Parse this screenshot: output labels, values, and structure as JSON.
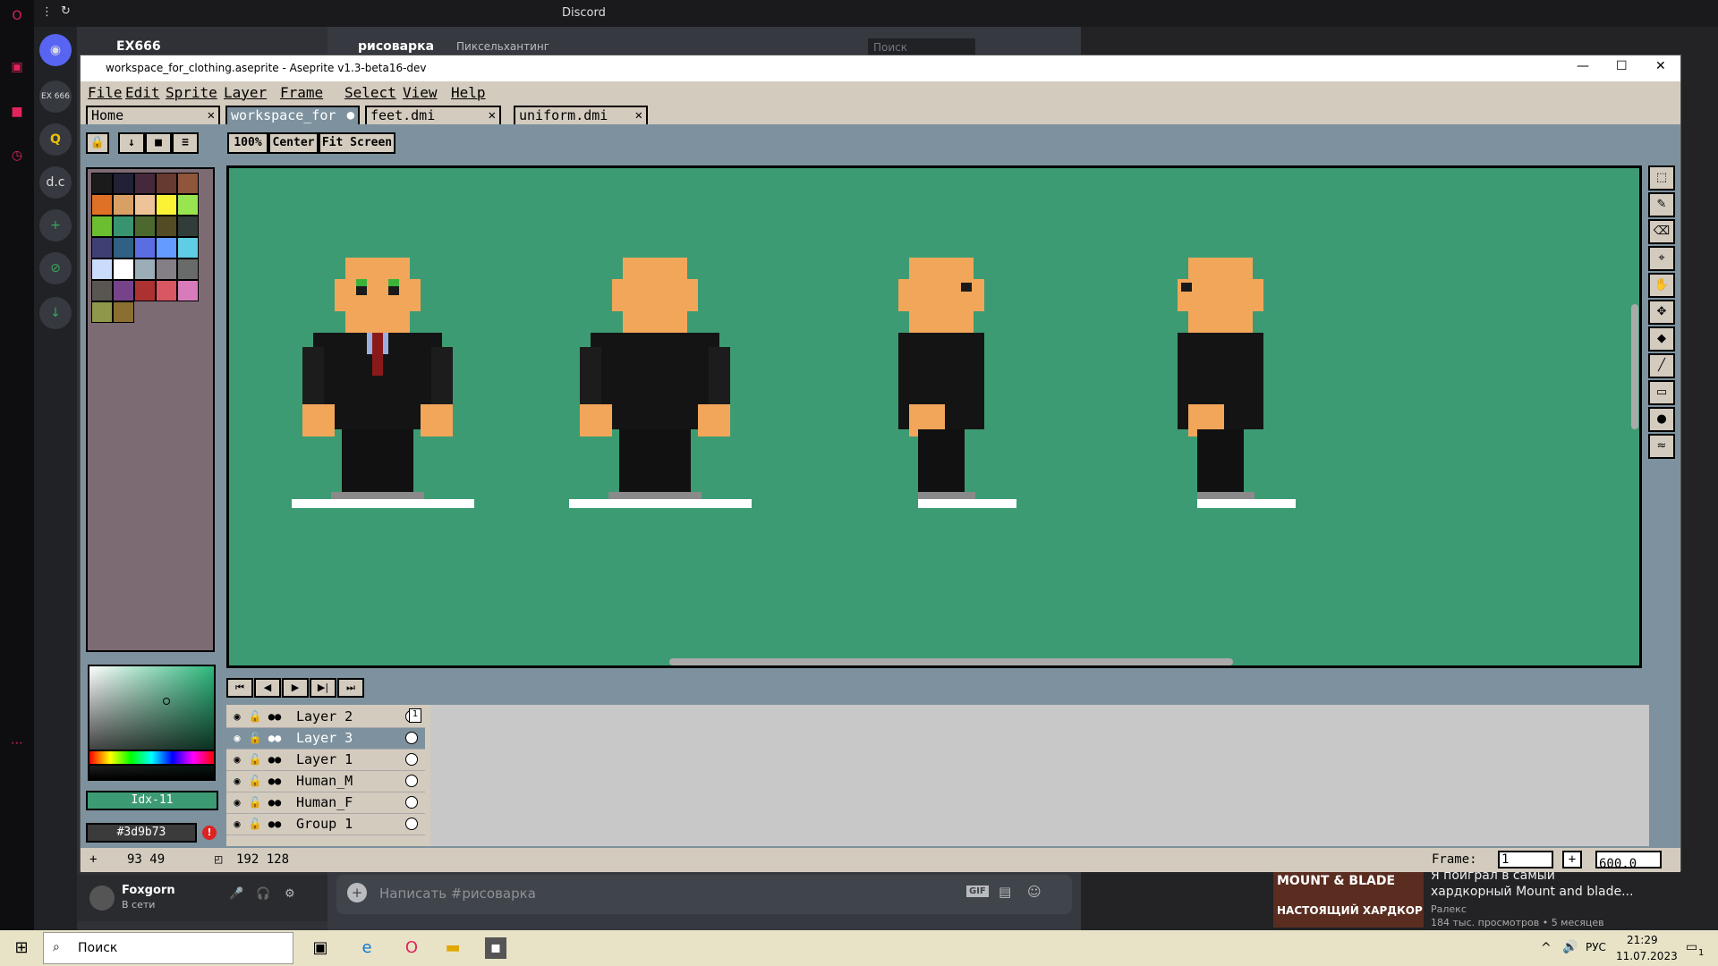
{
  "browser": {
    "title": "Discord"
  },
  "discord": {
    "server_name": "EX666",
    "channel_name": "рисоварка",
    "channel_topic": "Пиксельхантинг",
    "search_placeholder": "Поиск",
    "message_placeholder": "Написать #рисоварка",
    "user_name": "Foxgorn",
    "user_status": "В сети",
    "server_icons": [
      "EX 666",
      "Q",
      "d.c",
      "+"
    ],
    "gif_label": "GIF"
  },
  "aseprite": {
    "window_title": "workspace_for_clothing.aseprite - Aseprite v1.3-beta16-dev",
    "menu": [
      "File",
      "Edit",
      "Sprite",
      "Layer",
      "Frame",
      "Select",
      "View",
      "Help"
    ],
    "tabs": [
      {
        "label": "Home",
        "close": "✕"
      },
      {
        "label": "workspace_for",
        "close": "●"
      },
      {
        "label": "feet.dmi",
        "close": "✕"
      },
      {
        "label": "uniform.dmi",
        "close": "✕"
      }
    ],
    "zoom_buttons": {
      "zoom": "100%",
      "center": "Center",
      "fit": "Fit Screen"
    },
    "color_index": "Idx-11",
    "color_hex": "#3d9b73",
    "layers": [
      {
        "name": "Layer 2",
        "selected": false
      },
      {
        "name": "Layer 3",
        "selected": true
      },
      {
        "name": "Layer 1",
        "selected": false
      },
      {
        "name": "Human_M",
        "selected": false
      },
      {
        "name": "Human_F",
        "selected": false
      },
      {
        "name": "Group 1",
        "selected": false
      }
    ],
    "frame_header": "1",
    "status": {
      "cursor_pos": "93 49",
      "sprite_size": "192 128",
      "frame_label": "Frame:",
      "frame_value": "1",
      "zoom_value": "600.0"
    },
    "palette": [
      "#1b1b1b",
      "#222034",
      "#45283c",
      "#663931",
      "#8f563b",
      "#df7126",
      "#d9a066",
      "#eec39a",
      "#fbf236",
      "#99e550",
      "#6abe30",
      "#37946e",
      "#4b692f",
      "#524b24",
      "#323c39",
      "#3f3f74",
      "#306082",
      "#5b6ee1",
      "#639bff",
      "#5fcde4",
      "#cbdbfc",
      "#ffffff",
      "#9badb7",
      "#847e87",
      "#696a6a",
      "#595652",
      "#76428a",
      "#ac3232",
      "#d95763",
      "#d77bba",
      "#8f974a",
      "#8a6f30"
    ]
  },
  "ad": {
    "line1": "Я поиграл в самый",
    "line2": "хардкорный Mount and blade...",
    "channel": "Ралекс",
    "meta": "184 тыс. просмотров • 5 месяцев",
    "thumb_text": "НАСТОЯЩИЙ ХАРДКОР",
    "thumb_logo": "MOUNT & BLADE"
  },
  "taskbar": {
    "search": "Поиск",
    "time": "21:29",
    "date": "11.07.2023",
    "lang": "РУС",
    "notif": "1"
  }
}
